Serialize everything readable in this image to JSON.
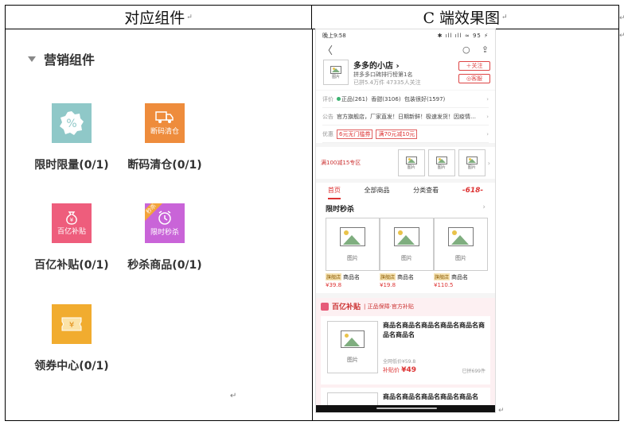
{
  "table": {
    "col_left_header": "对应组件",
    "col_right_header": "C 端效果图",
    "para_mark": "↵"
  },
  "left": {
    "section_title": "营销组件",
    "components": [
      {
        "label": "限时限量(0/1)",
        "icon": "percent-badge-icon",
        "icon_text": "%",
        "color": "#8fc8c8"
      },
      {
        "label": "断码清仓(0/1)",
        "icon": "truck-clearance-icon",
        "icon_text": "断码清仓",
        "color": "#ee8c3c"
      },
      {
        "label": "百亿补贴(0/1)",
        "icon": "money-bag-icon",
        "icon_text": "百亿补贴",
        "color": "#ee5d7c"
      },
      {
        "label": "秒杀商品(0/1)",
        "icon": "alarm-clock-icon",
        "icon_text": "限时秒杀",
        "corner": "秒杀",
        "color": "#c964d8"
      },
      {
        "label": "领券中心(0/1)",
        "icon": "coupon-ticket-icon",
        "icon_text": "¥",
        "color": "#f1ac2f"
      }
    ]
  },
  "phone": {
    "status": {
      "time": "晚上9:58",
      "right": "✱ ıll ıll ≈ 95 ⚡"
    },
    "nav": {
      "back": "〈",
      "search": "○",
      "share": "⇪"
    },
    "shop": {
      "logo_text": "图片",
      "name": "多多的小店 ›",
      "rank": "拼多多口碑排行榜第1名",
      "fans": "已拼5.4万件  47335人关注",
      "follow": "＋关注",
      "service": "◎客服"
    },
    "rows": [
      {
        "k": "评价",
        "v_parts": [
          "正品(261)",
          "香甜(3106)",
          "包装很好(1597)"
        ]
      },
      {
        "k": "公告",
        "v": "官方旗舰店，厂家直发！日期新鲜！极速发货！因疫情…"
      },
      {
        "k": "优惠",
        "coupons": [
          "6元无门槛券",
          "满70元减10元"
        ]
      }
    ],
    "promo": {
      "title": "满100减15专区",
      "thumb_text": "图片"
    },
    "tabs": [
      "首页",
      "全部商品",
      "分类查看",
      "-618-"
    ],
    "flash": {
      "title": "限时秒杀",
      "items": [
        {
          "img": "图片",
          "tag": "旗舰店",
          "name": "商品名",
          "price": "¥39.8"
        },
        {
          "img": "图片",
          "tag": "旗舰店",
          "name": "商品名",
          "price": "¥19.8"
        },
        {
          "img": "图片",
          "tag": "旗舰店",
          "name": "商品名",
          "price": "¥110.5"
        }
      ]
    },
    "subsidy": {
      "title": "百亿补贴",
      "subtitle": "| 正品保障·官方补贴",
      "card": {
        "img": "图片",
        "name": "商品名商品名商品名商品名商品名商品名商品名",
        "market": "全网低价¥59.8",
        "price_label": "补贴价 ",
        "price": "¥49",
        "sold": "已拼699件"
      },
      "card2_name": "商品名商品名商品名商品名商品名"
    }
  },
  "chevron": "›"
}
